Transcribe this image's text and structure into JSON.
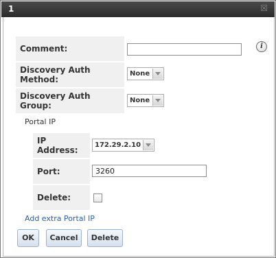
{
  "window": {
    "title": "1",
    "close_icon": "close-icon"
  },
  "form": {
    "comment": {
      "label": "Comment:",
      "value": ""
    },
    "discovery_auth_method": {
      "label": "Discovery Auth Method:",
      "value": "None"
    },
    "discovery_auth_group": {
      "label": "Discovery Auth Group:",
      "value": "None"
    },
    "portal_section_title": "Portal IP",
    "portal": {
      "ip_address": {
        "label": "IP Address:",
        "value": "172.29.2.10"
      },
      "port": {
        "label": "Port:",
        "value": "3260"
      },
      "delete": {
        "label": "Delete:",
        "checked": false
      }
    },
    "add_portal_link": "Add extra Portal IP",
    "info_icon": "info-icon"
  },
  "buttons": {
    "ok": "OK",
    "cancel": "Cancel",
    "delete": "Delete"
  }
}
